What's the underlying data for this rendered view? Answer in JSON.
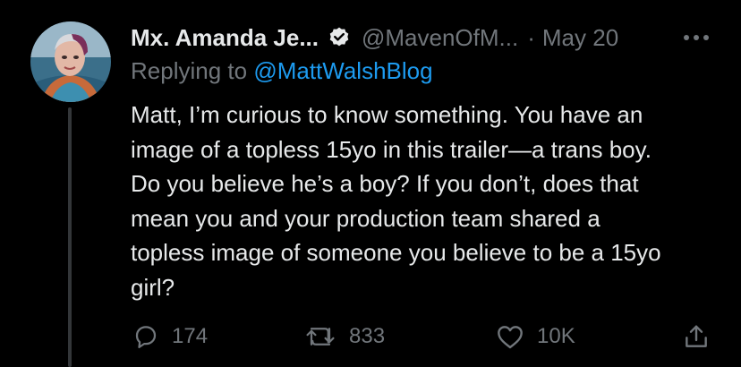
{
  "tweet": {
    "author_name": "Mx. Amanda Je...",
    "handle": "@MavenOfM...",
    "separator": "·",
    "date": "May 20",
    "replying_prefix": "Replying to",
    "replying_handle": "@MattWalshBlog",
    "body_lines": [
      "Matt, I’m curious to know something. You have an",
      "image of a topless 15yo in this trailer—a trans boy.",
      "Do you believe he’s a boy? If you don’t, does that",
      "mean you and your production team shared a",
      "topless image of someone you believe to be a 15yo",
      "girl?"
    ]
  },
  "actions": {
    "replies": "174",
    "retweets": "833",
    "likes": "10K"
  },
  "icons": {
    "verified": "verified-badge-icon",
    "more": "more-dots-icon",
    "reply": "reply-icon",
    "retweet": "retweet-icon",
    "like": "heart-icon",
    "share": "share-icon"
  },
  "colors": {
    "background": "#000000",
    "text": "#e7e9ea",
    "muted": "#71767b",
    "accent": "#1d9bf0",
    "thread_line": "#333639"
  }
}
